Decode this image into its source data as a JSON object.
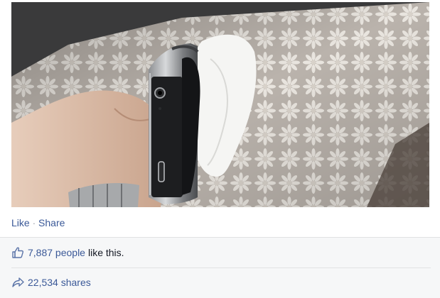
{
  "post": {
    "photo": {
      "alt_icon": "photo"
    },
    "actions": {
      "like_label": "Like",
      "separator": "·",
      "share_label": "Share"
    }
  },
  "ufi": {
    "likes": {
      "icon": "thumbs-up-icon",
      "count_label": "7,887 people",
      "suffix": "like this."
    },
    "shares": {
      "icon": "share-arrow-icon",
      "count_label": "22,534 shares"
    }
  },
  "colors": {
    "link": "#3b5998",
    "ufi_background": "#f6f7f8",
    "border": "#e1e2e3"
  }
}
